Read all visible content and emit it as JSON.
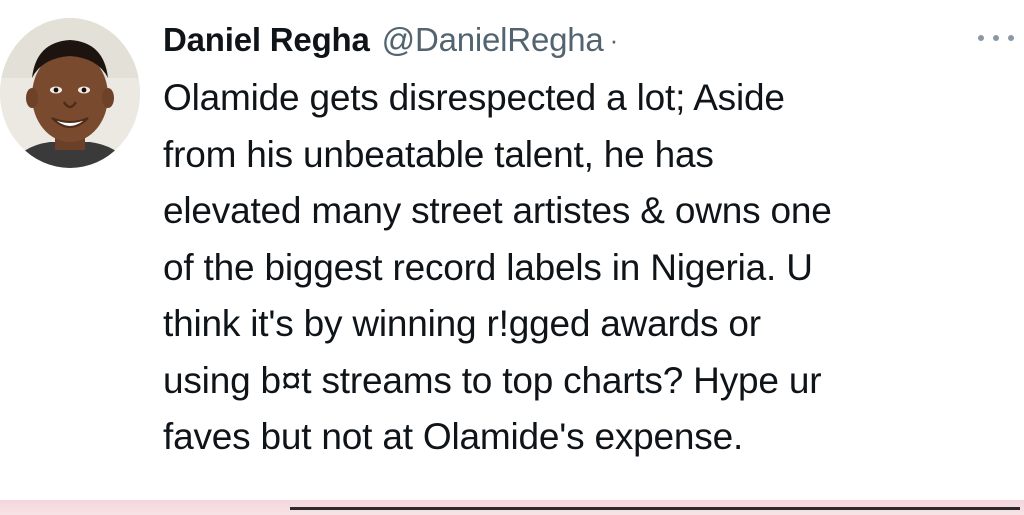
{
  "tweet": {
    "author": {
      "display_name": "Daniel Regha",
      "handle": "@DanielRegha",
      "separator": "·"
    },
    "more_icon": "more-horizontal-icon",
    "lines": [
      "Olamide gets disrespected a lot; Aside",
      "from his unbeatable talent, he has",
      "elevated many street artistes & owns one",
      "of the biggest record labels in Nigeria. U",
      "think it's by winning r!gged awards or",
      "using b¤t streams to top charts? Hype ur",
      "faves but not at Olamide's expense."
    ]
  },
  "colors": {
    "text_primary": "#0f1419",
    "text_secondary": "#536471",
    "bottom_band": "#f4d6dc"
  }
}
